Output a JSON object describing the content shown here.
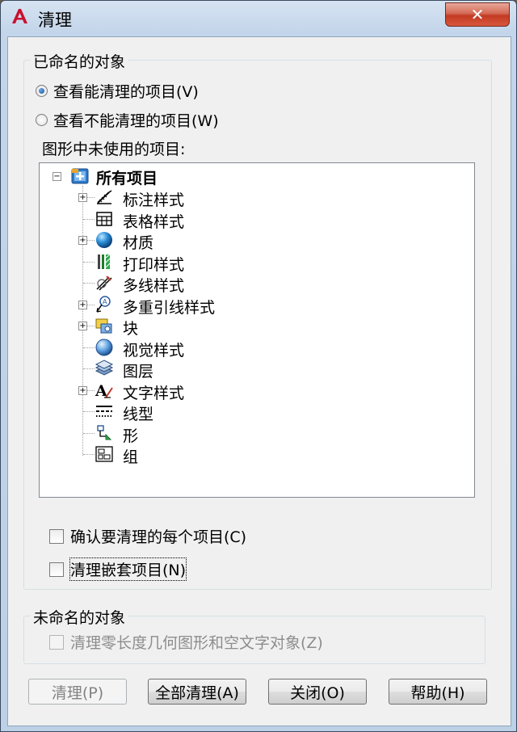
{
  "window": {
    "title": "清理",
    "close_glyph": "✕",
    "close_icon": "close-icon",
    "app_icon": "autocad-icon"
  },
  "named_objects": {
    "legend": "已命名的对象",
    "radio_can_purge": "查看能清理的项目(V)",
    "radio_cannot_purge": "查看不能清理的项目(W)",
    "selected_radio": "can_purge",
    "tree_caption": "图形中未使用的项目:",
    "tree": {
      "root": "所有项目",
      "items": [
        {
          "label": "标注样式",
          "icon": "dimension-style-icon",
          "expandable": true
        },
        {
          "label": "表格样式",
          "icon": "table-style-icon",
          "expandable": false
        },
        {
          "label": "材质",
          "icon": "material-icon",
          "expandable": true
        },
        {
          "label": "打印样式",
          "icon": "plot-style-icon",
          "expandable": false
        },
        {
          "label": "多线样式",
          "icon": "multiline-style-icon",
          "expandable": false
        },
        {
          "label": "多重引线样式",
          "icon": "multileader-style-icon",
          "expandable": true
        },
        {
          "label": "块",
          "icon": "block-icon",
          "expandable": true
        },
        {
          "label": "视觉样式",
          "icon": "visual-style-icon",
          "expandable": false
        },
        {
          "label": "图层",
          "icon": "layer-icon",
          "expandable": false
        },
        {
          "label": "文字样式",
          "icon": "text-style-icon",
          "expandable": true
        },
        {
          "label": "线型",
          "icon": "linetype-icon",
          "expandable": false
        },
        {
          "label": "形",
          "icon": "shape-icon",
          "expandable": false
        },
        {
          "label": "组",
          "icon": "group-icon",
          "expandable": false
        }
      ]
    },
    "confirm_each": "确认要清理的每个项目(C)",
    "confirm_each_checked": false,
    "purge_nested": "清理嵌套项目(N)",
    "purge_nested_checked": false
  },
  "unnamed_objects": {
    "legend": "未命名的对象",
    "zero_length": "清理零长度几何图形和空文字对象(Z)",
    "zero_length_checked": false,
    "zero_length_enabled": false
  },
  "buttons": {
    "purge": "清理(P)",
    "purge_all": "全部清理(A)",
    "close": "关闭(O)",
    "help": "帮助(H)"
  },
  "colors": {
    "title_bar": "#c3d5ea",
    "close_button": "#c23a22",
    "dialog_face": "#f0f0f0"
  }
}
